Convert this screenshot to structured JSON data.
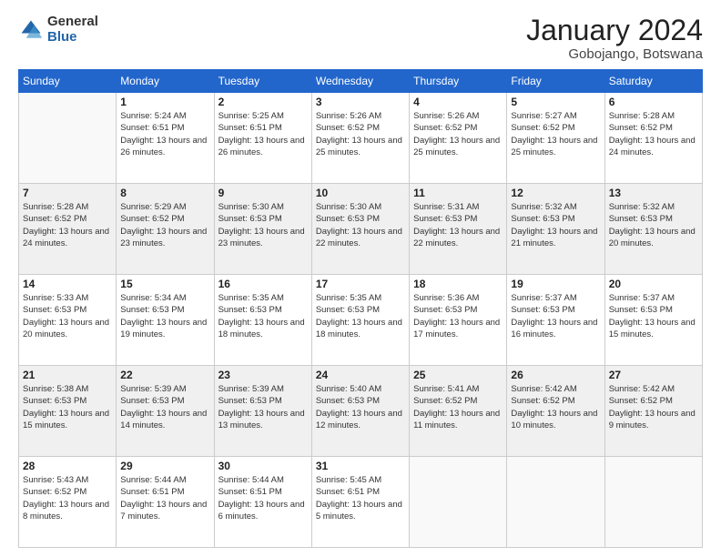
{
  "logo": {
    "general": "General",
    "blue": "Blue"
  },
  "title": "January 2024",
  "subtitle": "Gobojango, Botswana",
  "days_of_week": [
    "Sunday",
    "Monday",
    "Tuesday",
    "Wednesday",
    "Thursday",
    "Friday",
    "Saturday"
  ],
  "weeks": [
    [
      {
        "day": "",
        "sunrise": "",
        "sunset": "",
        "daylight": ""
      },
      {
        "day": "1",
        "sunrise": "Sunrise: 5:24 AM",
        "sunset": "Sunset: 6:51 PM",
        "daylight": "Daylight: 13 hours and 26 minutes."
      },
      {
        "day": "2",
        "sunrise": "Sunrise: 5:25 AM",
        "sunset": "Sunset: 6:51 PM",
        "daylight": "Daylight: 13 hours and 26 minutes."
      },
      {
        "day": "3",
        "sunrise": "Sunrise: 5:26 AM",
        "sunset": "Sunset: 6:52 PM",
        "daylight": "Daylight: 13 hours and 25 minutes."
      },
      {
        "day": "4",
        "sunrise": "Sunrise: 5:26 AM",
        "sunset": "Sunset: 6:52 PM",
        "daylight": "Daylight: 13 hours and 25 minutes."
      },
      {
        "day": "5",
        "sunrise": "Sunrise: 5:27 AM",
        "sunset": "Sunset: 6:52 PM",
        "daylight": "Daylight: 13 hours and 25 minutes."
      },
      {
        "day": "6",
        "sunrise": "Sunrise: 5:28 AM",
        "sunset": "Sunset: 6:52 PM",
        "daylight": "Daylight: 13 hours and 24 minutes."
      }
    ],
    [
      {
        "day": "7",
        "sunrise": "Sunrise: 5:28 AM",
        "sunset": "Sunset: 6:52 PM",
        "daylight": "Daylight: 13 hours and 24 minutes."
      },
      {
        "day": "8",
        "sunrise": "Sunrise: 5:29 AM",
        "sunset": "Sunset: 6:52 PM",
        "daylight": "Daylight: 13 hours and 23 minutes."
      },
      {
        "day": "9",
        "sunrise": "Sunrise: 5:30 AM",
        "sunset": "Sunset: 6:53 PM",
        "daylight": "Daylight: 13 hours and 23 minutes."
      },
      {
        "day": "10",
        "sunrise": "Sunrise: 5:30 AM",
        "sunset": "Sunset: 6:53 PM",
        "daylight": "Daylight: 13 hours and 22 minutes."
      },
      {
        "day": "11",
        "sunrise": "Sunrise: 5:31 AM",
        "sunset": "Sunset: 6:53 PM",
        "daylight": "Daylight: 13 hours and 22 minutes."
      },
      {
        "day": "12",
        "sunrise": "Sunrise: 5:32 AM",
        "sunset": "Sunset: 6:53 PM",
        "daylight": "Daylight: 13 hours and 21 minutes."
      },
      {
        "day": "13",
        "sunrise": "Sunrise: 5:32 AM",
        "sunset": "Sunset: 6:53 PM",
        "daylight": "Daylight: 13 hours and 20 minutes."
      }
    ],
    [
      {
        "day": "14",
        "sunrise": "Sunrise: 5:33 AM",
        "sunset": "Sunset: 6:53 PM",
        "daylight": "Daylight: 13 hours and 20 minutes."
      },
      {
        "day": "15",
        "sunrise": "Sunrise: 5:34 AM",
        "sunset": "Sunset: 6:53 PM",
        "daylight": "Daylight: 13 hours and 19 minutes."
      },
      {
        "day": "16",
        "sunrise": "Sunrise: 5:35 AM",
        "sunset": "Sunset: 6:53 PM",
        "daylight": "Daylight: 13 hours and 18 minutes."
      },
      {
        "day": "17",
        "sunrise": "Sunrise: 5:35 AM",
        "sunset": "Sunset: 6:53 PM",
        "daylight": "Daylight: 13 hours and 18 minutes."
      },
      {
        "day": "18",
        "sunrise": "Sunrise: 5:36 AM",
        "sunset": "Sunset: 6:53 PM",
        "daylight": "Daylight: 13 hours and 17 minutes."
      },
      {
        "day": "19",
        "sunrise": "Sunrise: 5:37 AM",
        "sunset": "Sunset: 6:53 PM",
        "daylight": "Daylight: 13 hours and 16 minutes."
      },
      {
        "day": "20",
        "sunrise": "Sunrise: 5:37 AM",
        "sunset": "Sunset: 6:53 PM",
        "daylight": "Daylight: 13 hours and 15 minutes."
      }
    ],
    [
      {
        "day": "21",
        "sunrise": "Sunrise: 5:38 AM",
        "sunset": "Sunset: 6:53 PM",
        "daylight": "Daylight: 13 hours and 15 minutes."
      },
      {
        "day": "22",
        "sunrise": "Sunrise: 5:39 AM",
        "sunset": "Sunset: 6:53 PM",
        "daylight": "Daylight: 13 hours and 14 minutes."
      },
      {
        "day": "23",
        "sunrise": "Sunrise: 5:39 AM",
        "sunset": "Sunset: 6:53 PM",
        "daylight": "Daylight: 13 hours and 13 minutes."
      },
      {
        "day": "24",
        "sunrise": "Sunrise: 5:40 AM",
        "sunset": "Sunset: 6:53 PM",
        "daylight": "Daylight: 13 hours and 12 minutes."
      },
      {
        "day": "25",
        "sunrise": "Sunrise: 5:41 AM",
        "sunset": "Sunset: 6:52 PM",
        "daylight": "Daylight: 13 hours and 11 minutes."
      },
      {
        "day": "26",
        "sunrise": "Sunrise: 5:42 AM",
        "sunset": "Sunset: 6:52 PM",
        "daylight": "Daylight: 13 hours and 10 minutes."
      },
      {
        "day": "27",
        "sunrise": "Sunrise: 5:42 AM",
        "sunset": "Sunset: 6:52 PM",
        "daylight": "Daylight: 13 hours and 9 minutes."
      }
    ],
    [
      {
        "day": "28",
        "sunrise": "Sunrise: 5:43 AM",
        "sunset": "Sunset: 6:52 PM",
        "daylight": "Daylight: 13 hours and 8 minutes."
      },
      {
        "day": "29",
        "sunrise": "Sunrise: 5:44 AM",
        "sunset": "Sunset: 6:51 PM",
        "daylight": "Daylight: 13 hours and 7 minutes."
      },
      {
        "day": "30",
        "sunrise": "Sunrise: 5:44 AM",
        "sunset": "Sunset: 6:51 PM",
        "daylight": "Daylight: 13 hours and 6 minutes."
      },
      {
        "day": "31",
        "sunrise": "Sunrise: 5:45 AM",
        "sunset": "Sunset: 6:51 PM",
        "daylight": "Daylight: 13 hours and 5 minutes."
      },
      {
        "day": "",
        "sunrise": "",
        "sunset": "",
        "daylight": ""
      },
      {
        "day": "",
        "sunrise": "",
        "sunset": "",
        "daylight": ""
      },
      {
        "day": "",
        "sunrise": "",
        "sunset": "",
        "daylight": ""
      }
    ]
  ]
}
